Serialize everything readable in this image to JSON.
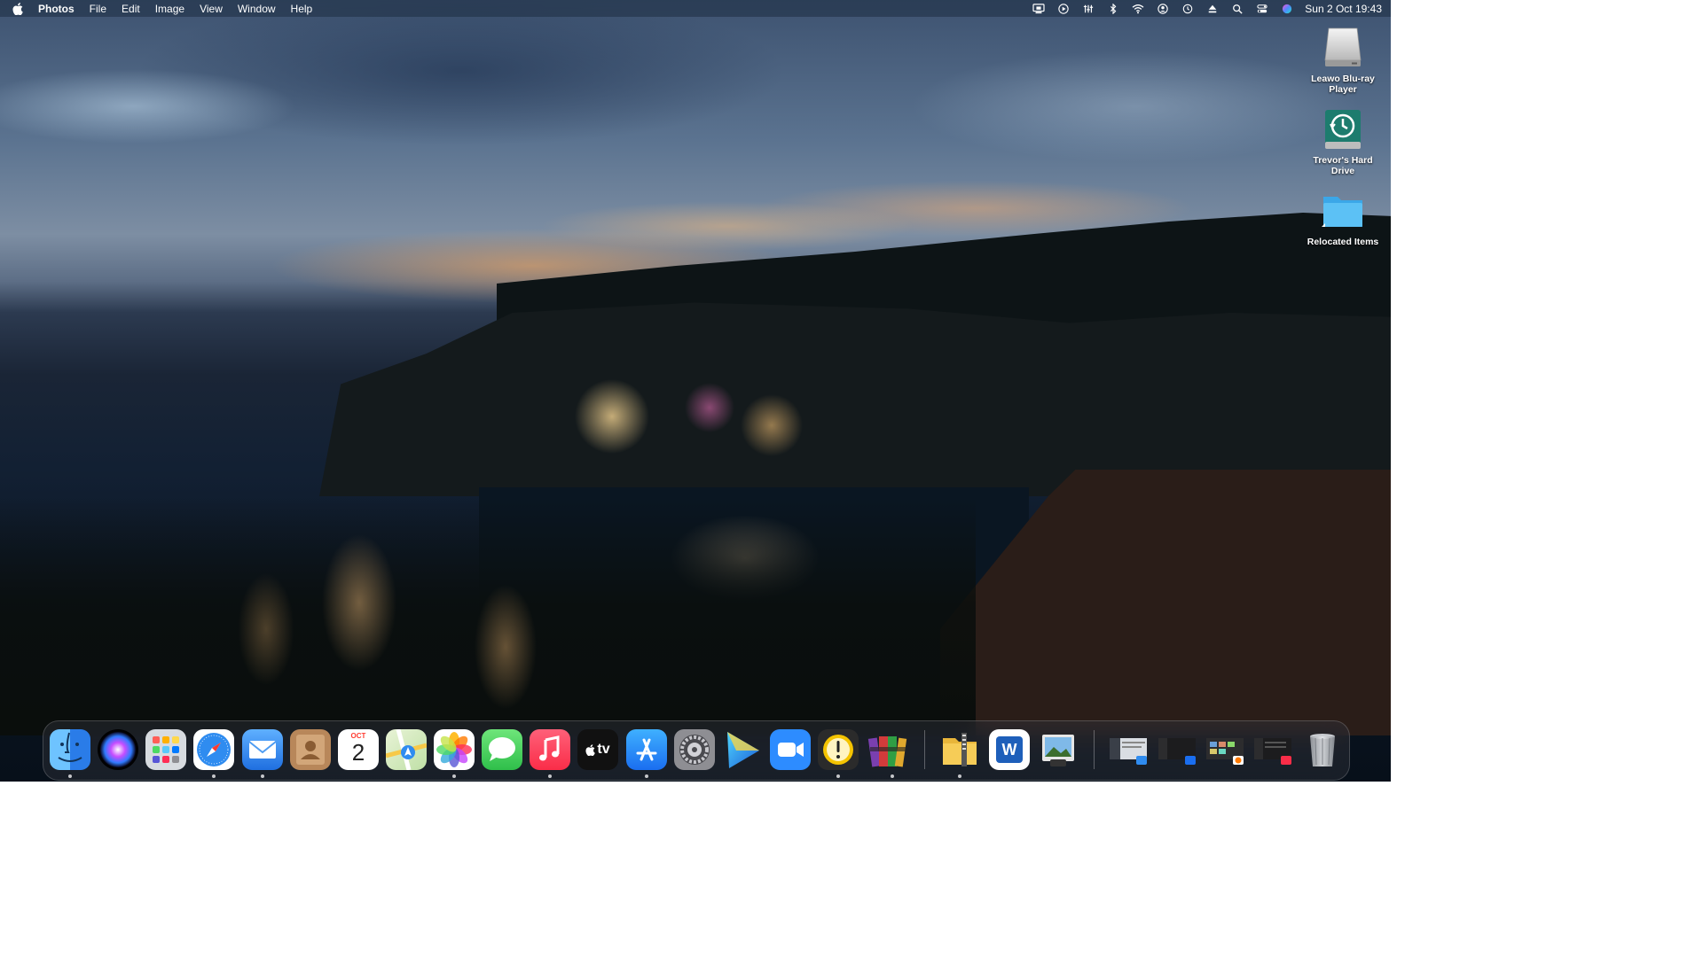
{
  "menubar": {
    "apple_icon": "apple-icon",
    "app_name": "Photos",
    "menus": [
      "File",
      "Edit",
      "Image",
      "View",
      "Window",
      "Help"
    ],
    "status_icons": [
      "screen-mirroring-icon",
      "play-icon",
      "network-tool-icon",
      "bluetooth-icon",
      "wifi-icon",
      "user-icon",
      "time-machine-icon",
      "eject-icon",
      "spotlight-search-icon",
      "control-centre-icon",
      "siri-icon"
    ],
    "clock": "Sun 2 Oct  19:43"
  },
  "desktop_icons": [
    {
      "label": "Leawo Blu-ray Player",
      "icon": "external-drive-icon"
    },
    {
      "label": "Trevor's Hard Drive",
      "icon": "time-machine-drive-icon"
    },
    {
      "label": "Relocated Items",
      "icon": "folder-icon"
    }
  ],
  "dock": {
    "apps": [
      {
        "name": "Finder",
        "icon": "finder-icon",
        "running": true
      },
      {
        "name": "Siri",
        "icon": "siri-icon",
        "running": false
      },
      {
        "name": "Launchpad",
        "icon": "launchpad-icon",
        "running": false
      },
      {
        "name": "Safari",
        "icon": "safari-icon",
        "running": true
      },
      {
        "name": "Mail",
        "icon": "mail-icon",
        "running": true
      },
      {
        "name": "Contacts",
        "icon": "contacts-icon",
        "running": false
      },
      {
        "name": "Calendar",
        "icon": "calendar-icon",
        "running": false,
        "month": "OCT",
        "day": "2"
      },
      {
        "name": "Maps",
        "icon": "maps-icon",
        "running": false
      },
      {
        "name": "Photos",
        "icon": "photos-icon",
        "running": true
      },
      {
        "name": "Messages",
        "icon": "messages-icon",
        "running": false
      },
      {
        "name": "Music",
        "icon": "music-icon",
        "running": true
      },
      {
        "name": "TV",
        "icon": "apple-tv-icon",
        "running": false,
        "text": "tv"
      },
      {
        "name": "App Store",
        "icon": "app-store-icon",
        "running": true
      },
      {
        "name": "System Preferences",
        "icon": "system-preferences-icon",
        "running": false
      },
      {
        "name": "Infuse",
        "icon": "play-triangle-icon",
        "running": false
      },
      {
        "name": "Zoom",
        "icon": "zoom-icon",
        "running": false
      },
      {
        "name": "Alarm",
        "icon": "clock-alert-icon",
        "running": true
      },
      {
        "name": "Archive Utility",
        "icon": "books-archive-icon",
        "running": true
      }
    ],
    "apps2": [
      {
        "name": "Archive",
        "icon": "zip-folder-icon",
        "running": true
      },
      {
        "name": "Word",
        "icon": "word-icon",
        "running": false,
        "text": "W"
      },
      {
        "name": "Preview",
        "icon": "preview-icon",
        "running": false
      }
    ],
    "minimized": [
      {
        "name": "Mail window",
        "icon": "mail-window-thumbnail-icon"
      },
      {
        "name": "App Store window",
        "icon": "app-store-window-thumbnail-icon"
      },
      {
        "name": "Photos window",
        "icon": "photos-window-thumbnail-icon"
      },
      {
        "name": "Music window",
        "icon": "music-window-thumbnail-icon"
      }
    ],
    "trash_icon": "trash-icon"
  },
  "colors": {
    "finder_blue": "#3b8ff0",
    "safari_blue": "#2f8cf0",
    "messages_green": "#34c759",
    "music_red": "#fa3a55",
    "word_blue": "#1e5fba",
    "zoom_blue": "#2d8cff"
  }
}
